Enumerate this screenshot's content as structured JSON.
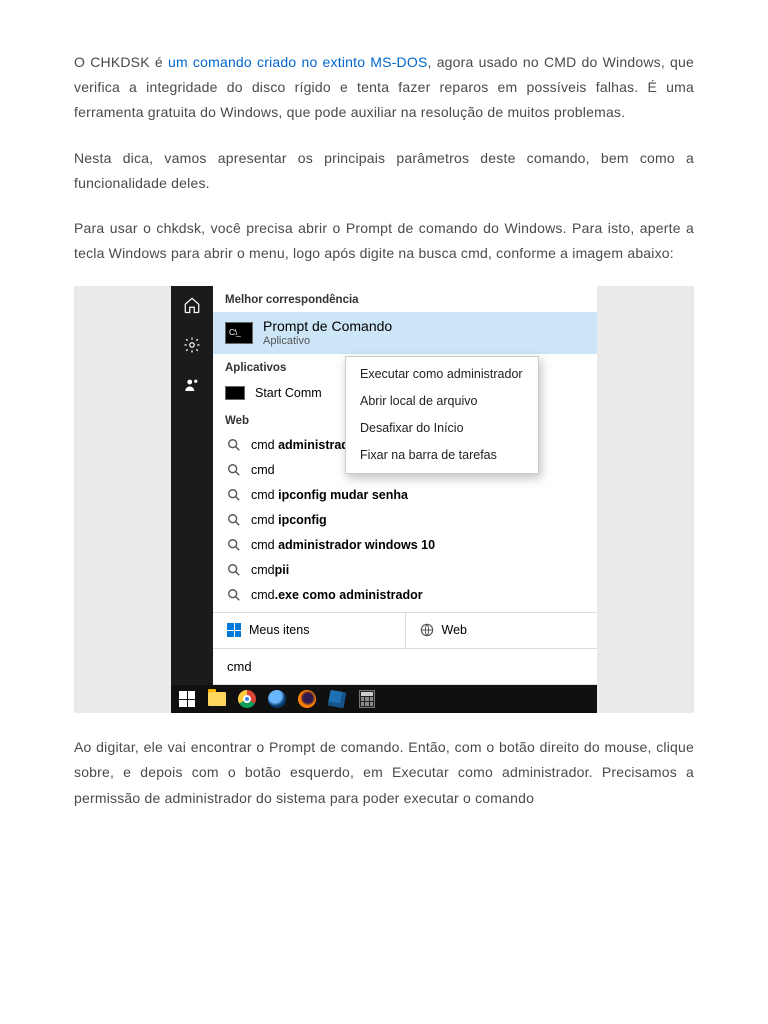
{
  "para1_a": "O CHKDSK é ",
  "para1_link": "um comando criado no extinto MS-DOS",
  "para1_b": ", agora usado no CMD do Windows, que verifica a integridade do disco rígido e tenta fazer reparos em possíveis falhas. É uma ferramenta gratuita do Windows, que pode auxiliar na resolução de muitos problemas.",
  "para2": "Nesta dica, vamos apresentar os principais parâmetros deste comando, bem como a funcionalidade deles.",
  "para3": "Para usar o chkdsk, você precisa abrir o Prompt de comando do Windows. Para isto, aperte a tecla Windows para abrir o menu, logo após digite na busca cmd, conforme a imagem abaixo:",
  "para4": "Ao digitar, ele vai encontrar o Prompt de comando. Então, com o botão direito do mouse, clique sobre, e depois com o botão esquerdo, em Executar como administrador. Precisamos a permissão de administrador do sistema para poder executar o comando",
  "startmenu": {
    "best_header": "Melhor correspondência",
    "best_title": "Prompt de Comando",
    "best_sub": "Aplicativo",
    "apps_header": "Aplicativos",
    "apps_item": "Start Comm",
    "web_header": "Web",
    "context": {
      "run_admin": "Executar como administrador",
      "open_loc": "Abrir local de arquivo",
      "unpin": "Desafixar do Início",
      "pin_tb": "Fixar na barra de tarefas"
    },
    "suggestions": [
      {
        "pre": "cmd ",
        "bold": "administrador"
      },
      {
        "pre": "cmd",
        "bold": ""
      },
      {
        "pre": "cmd ",
        "bold": "ipconfig mudar senha"
      },
      {
        "pre": "cmd ",
        "bold": "ipconfig"
      },
      {
        "pre": "cmd ",
        "bold": "administrador windows 10"
      },
      {
        "pre": "cmd",
        "bold": "pii"
      },
      {
        "pre": "cmd",
        "bold": ".exe como administrador"
      }
    ],
    "tab_my": "Meus itens",
    "tab_web": "Web",
    "query": "cmd"
  }
}
